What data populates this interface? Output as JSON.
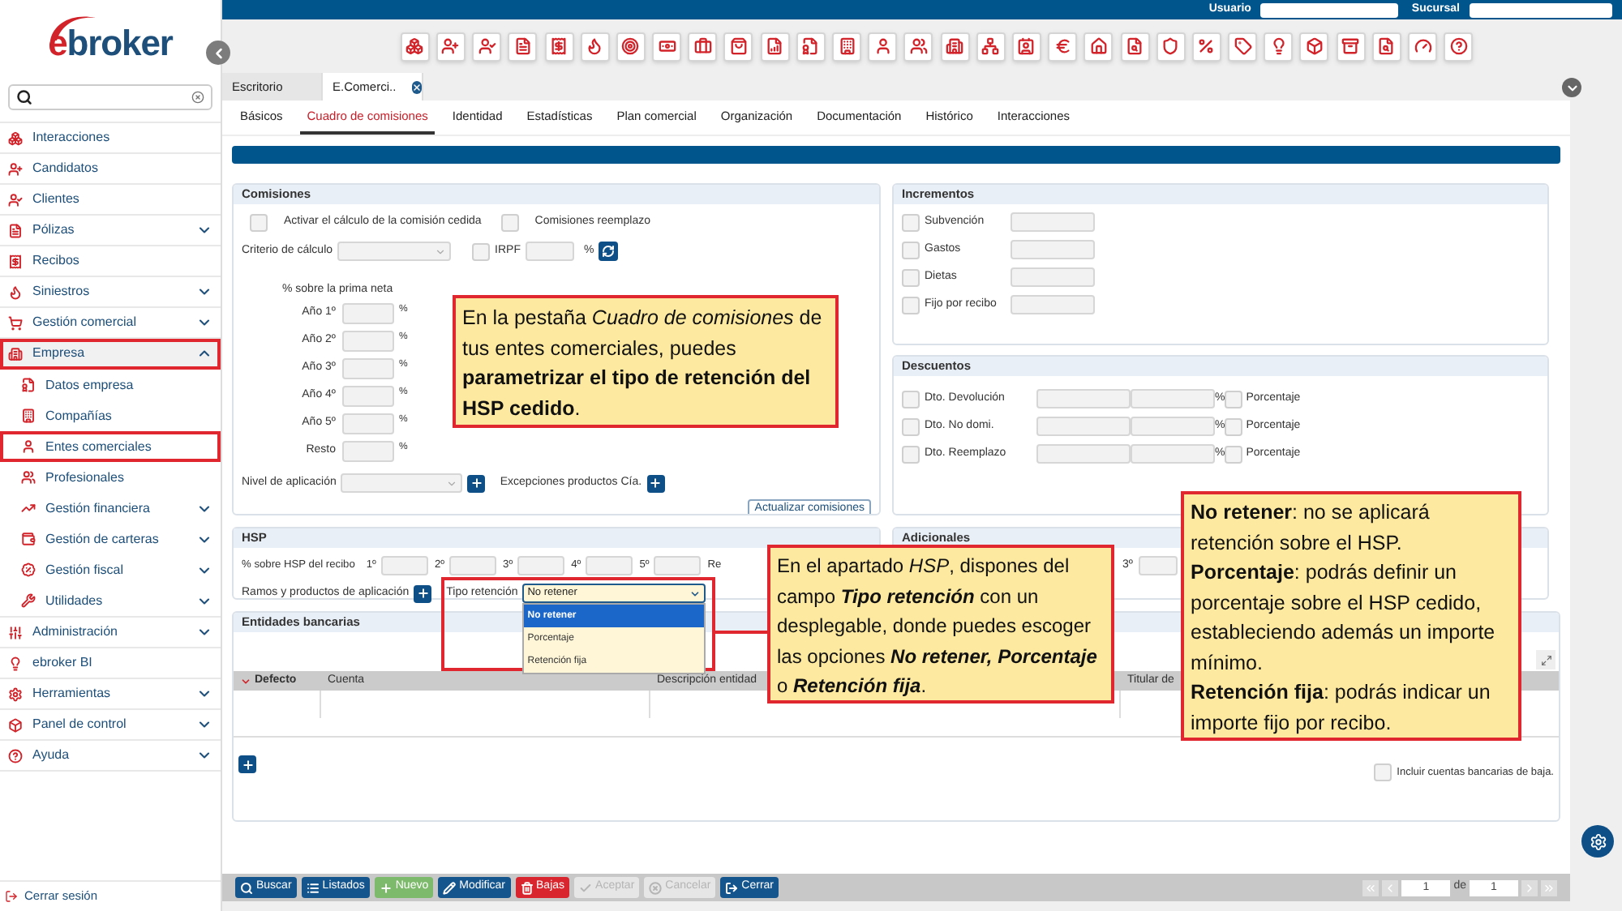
{
  "top_bar": {
    "user_label": "Usuario",
    "branch_label": "Sucursal"
  },
  "logo": "ebroker",
  "sidebar": {
    "items": [
      {
        "label": "Interacciones",
        "expandable": false,
        "expanded": false,
        "highlighted": false
      },
      {
        "label": "Candidatos",
        "expandable": false,
        "expanded": false,
        "highlighted": false
      },
      {
        "label": "Clientes",
        "expandable": false,
        "expanded": false,
        "highlighted": false
      },
      {
        "label": "Pólizas",
        "expandable": true,
        "expanded": false,
        "highlighted": false
      },
      {
        "label": "Recibos",
        "expandable": false,
        "expanded": false,
        "highlighted": false
      },
      {
        "label": "Siniestros",
        "expandable": true,
        "expanded": false,
        "highlighted": false
      },
      {
        "label": "Gestión comercial",
        "expandable": true,
        "expanded": false,
        "highlighted": false
      },
      {
        "label": "Empresa",
        "expandable": true,
        "expanded": true,
        "highlighted": true,
        "children": [
          {
            "label": "Datos empresa",
            "expandable": false,
            "expanded": false,
            "highlighted": false
          },
          {
            "label": "Compañías",
            "expandable": false,
            "expanded": false,
            "highlighted": false
          },
          {
            "label": "Entes comerciales",
            "expandable": false,
            "expanded": false,
            "highlighted": true
          },
          {
            "label": "Profesionales",
            "expandable": false,
            "expanded": false,
            "highlighted": false
          },
          {
            "label": "Gestión financiera",
            "expandable": true,
            "expanded": false,
            "highlighted": false
          },
          {
            "label": "Gestión de carteras",
            "expandable": true,
            "expanded": false,
            "highlighted": false
          },
          {
            "label": "Gestión fiscal",
            "expandable": true,
            "expanded": false,
            "highlighted": false
          },
          {
            "label": "Utilidades",
            "expandable": true,
            "expanded": false,
            "highlighted": false
          }
        ]
      },
      {
        "label": "Administración",
        "expandable": true,
        "expanded": false,
        "highlighted": false
      },
      {
        "label": "ebroker BI",
        "expandable": false,
        "expanded": false,
        "highlighted": false
      },
      {
        "label": "Herramientas",
        "expandable": true,
        "expanded": false,
        "highlighted": false
      },
      {
        "label": "Panel de control",
        "expandable": true,
        "expanded": false,
        "highlighted": false
      },
      {
        "label": "Ayuda",
        "expandable": true,
        "expanded": false,
        "highlighted": false
      }
    ],
    "logout": "Cerrar sesión"
  },
  "tabs": [
    {
      "label": "Escritorio",
      "selected": false,
      "closable": false
    },
    {
      "label": "E.Comerci..",
      "selected": true,
      "closable": true
    }
  ],
  "subtabs": [
    {
      "label": "Básicos",
      "selected": false
    },
    {
      "label": "Cuadro de comisiones",
      "selected": true
    },
    {
      "label": "Identidad",
      "selected": false
    },
    {
      "label": "Estadísticas",
      "selected": false
    },
    {
      "label": "Plan comercial",
      "selected": false
    },
    {
      "label": "Organización",
      "selected": false
    },
    {
      "label": "Documentación",
      "selected": false
    },
    {
      "label": "Histórico",
      "selected": false
    },
    {
      "label": "Interacciones",
      "selected": false
    }
  ],
  "commissions": {
    "title": "Comisiones",
    "checks": [
      {
        "label": "Activar el cálculo de la comisión cedida",
        "checked": false
      },
      {
        "label": "Comisiones reemplazo",
        "checked": false
      }
    ],
    "criteria_label": "Criterio de cálculo",
    "irpf": {
      "label": "IRPF",
      "checked": false,
      "unit": "%"
    },
    "heading": "% sobre la prima neta",
    "years": [
      {
        "label": "Año 1º",
        "unit": "%"
      },
      {
        "label": "Año 2º",
        "unit": "%"
      },
      {
        "label": "Año 3º",
        "unit": "%"
      },
      {
        "label": "Año 4º",
        "unit": "%"
      },
      {
        "label": "Año 5º",
        "unit": "%"
      },
      {
        "label": "Resto",
        "unit": "%"
      }
    ],
    "level_label": "Nivel de aplicación",
    "exceptions_label": "Excepciones productos Cía.",
    "update_button": "Actualizar comisiones"
  },
  "increments": {
    "title": "Incrementos",
    "rows": [
      {
        "label": "Subvención",
        "checked": false
      },
      {
        "label": "Gastos",
        "checked": false
      },
      {
        "label": "Dietas",
        "checked": false
      },
      {
        "label": "Fijo por recibo",
        "checked": false
      }
    ]
  },
  "discounts": {
    "title": "Descuentos",
    "rows": [
      {
        "label": "Dto. Devolución",
        "unit": "%",
        "option": "Porcentaje",
        "checked": false,
        "option_checked": false
      },
      {
        "label": "Dto. No domi.",
        "unit": "%",
        "option": "Porcentaje",
        "checked": false,
        "option_checked": false
      },
      {
        "label": "Dto. Reemplazo",
        "unit": "%",
        "option": "Porcentaje",
        "checked": false,
        "option_checked": false
      }
    ]
  },
  "hsp": {
    "title": "HSP",
    "label": "% sobre HSP del recibo",
    "slots": [
      "1º",
      "2º",
      "3º",
      "4º",
      "5º",
      "Re"
    ],
    "products_label": "Ramos y productos de aplicación",
    "retention": {
      "label": "Tipo retención",
      "value": "No retener",
      "expanded": true,
      "options": [
        {
          "label": "No retener",
          "selected": true
        },
        {
          "label": "Porcentaje",
          "selected": false
        },
        {
          "label": "Retención fija",
          "selected": false
        }
      ]
    }
  },
  "additional": {
    "title": "Adicionales",
    "slots": [
      "3º"
    ]
  },
  "bank": {
    "title": "Entidades bancarias",
    "columns": [
      {
        "label": "Defecto",
        "sorted": true
      },
      {
        "label": "Cuenta",
        "sorted": false
      },
      {
        "label": "Descripción entidad",
        "sorted": false
      },
      {
        "label": "Titular de",
        "sorted": false
      }
    ],
    "include_inactive": {
      "label": "Incluir cuentas bancarias de baja.",
      "checked": false
    }
  },
  "actions": [
    {
      "label": "Buscar",
      "kind": "search",
      "disabled": false
    },
    {
      "label": "Listados",
      "kind": "list",
      "disabled": false
    },
    {
      "label": "Nuevo",
      "kind": "new",
      "disabled": false
    },
    {
      "label": "Modificar",
      "kind": "edit",
      "disabled": false
    },
    {
      "label": "Bajas",
      "kind": "delete",
      "disabled": false
    },
    {
      "label": "Aceptar",
      "kind": "accept",
      "disabled": true
    },
    {
      "label": "Cancelar",
      "kind": "cancel",
      "disabled": true
    },
    {
      "label": "Cerrar",
      "kind": "close",
      "disabled": false
    }
  ],
  "pager": {
    "page": "1",
    "of_label": "de",
    "total": "1"
  },
  "callouts": [
    {
      "kind": "intro",
      "paragraphs": [
        "En la pestaña *Cuadro de comisiones* de tus entes comerciales, puedes **parametrizar el tipo de retención del HSP cedido**."
      ]
    },
    {
      "kind": "hsp",
      "paragraphs": [
        "En el apartado *HSP*, dispones del campo **Tipo retención** con un desplegable, donde puedes escoger las opciones **No retener, Porcentaje** o **Retención fija**."
      ]
    },
    {
      "kind": "options",
      "paragraphs": [
        "**No retener**: no se aplicará retención sobre el HSP.",
        "**Porcentaje**: podrás definir un porcentaje sobre el HSP cedido, estableciendo además un importe mínimo.",
        "**Retención fija**: podrás indicar un importe fijo por recibo."
      ]
    }
  ]
}
